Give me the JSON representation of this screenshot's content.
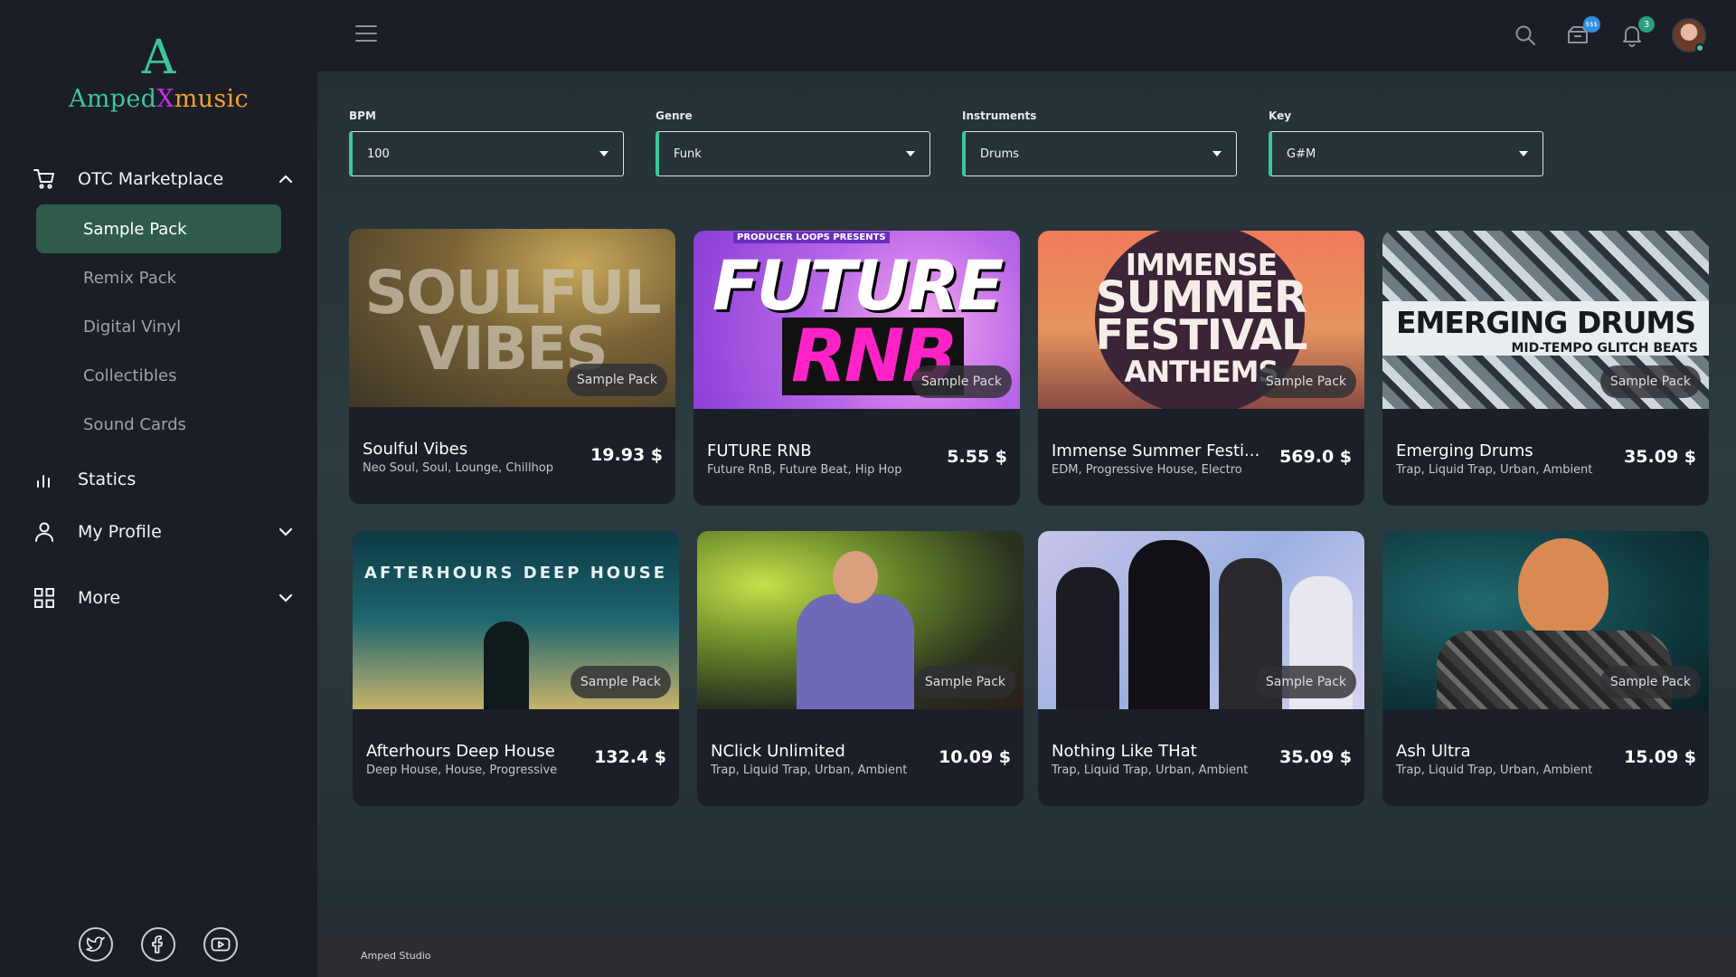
{
  "brand": {
    "mark": "A",
    "name_part1": "Amped",
    "name_part2": "X",
    "name_part3": "music"
  },
  "sidebar": {
    "marketplace_label": "OTC Marketplace",
    "sub_items": [
      {
        "label": "Sample Pack",
        "active": true
      },
      {
        "label": "Remix Pack",
        "active": false
      },
      {
        "label": "Digital Vinyl",
        "active": false
      },
      {
        "label": "Collectibles",
        "active": false
      },
      {
        "label": "Sound Cards",
        "active": false
      }
    ],
    "statics_label": "Statics",
    "profile_label": "My Profile",
    "more_label": "More"
  },
  "topbar": {
    "wallet_badge": "$$$",
    "notification_badge": "3"
  },
  "filters": [
    {
      "label": "BPM",
      "value": "100"
    },
    {
      "label": "Genre",
      "value": "Funk"
    },
    {
      "label": "Instruments",
      "value": "Drums"
    },
    {
      "label": "Key",
      "value": "G#M"
    }
  ],
  "card_badge": "Sample Pack",
  "cards": [
    {
      "title": "Soulful Vibes",
      "tags": "Neo Soul, Soul, Lounge, Chillhop",
      "price": "19.93 $",
      "art_line1": "SOULFUL",
      "art_line2": "VIBES"
    },
    {
      "title": "FUTURE RNB",
      "tags": "Future RnB, Future Beat, Hip Hop",
      "price": "5.55 $",
      "art_top": "PRODUCER LOOPS PRESENTS",
      "art_line1": "FUTURE",
      "art_line2": "RNB"
    },
    {
      "title": "Immense Summer Festi...",
      "tags": "EDM, Progressive House, Electro",
      "price": "569.0 $",
      "art_line1": "IMMENSE",
      "art_line2": "SUMMER",
      "art_line3": "FESTIVAL",
      "art_line4": "ANTHEMS"
    },
    {
      "title": "Emerging Drums",
      "tags": "Trap, Liquid Trap, Urban, Ambient",
      "price": "35.09 $",
      "art_line1": "EMERGING DRUMS",
      "art_line2": "MID-TEMPO GLITCH BEATS"
    },
    {
      "title": "Afterhours Deep House",
      "tags": "Deep House, House, Progressive",
      "price": "132.4 $",
      "art_line1": "AFTERHOURS DEEP HOUSE"
    },
    {
      "title": "NClick Unlimited",
      "tags": "Trap, Liquid Trap, Urban, Ambient",
      "price": "10.09 $"
    },
    {
      "title": "Nothing Like THat",
      "tags": "Trap, Liquid Trap, Urban, Ambient",
      "price": "35.09 $"
    },
    {
      "title": "Ash Ultra",
      "tags": "Trap, Liquid Trap, Urban, Ambient",
      "price": "15.09 $"
    }
  ],
  "footer": {
    "text": "Amped Studio"
  },
  "colors": {
    "accent": "#3ec59a",
    "brand_x": "#c531e6",
    "brand_music": "#f0a032",
    "active_nav": "#2e5b4a"
  }
}
